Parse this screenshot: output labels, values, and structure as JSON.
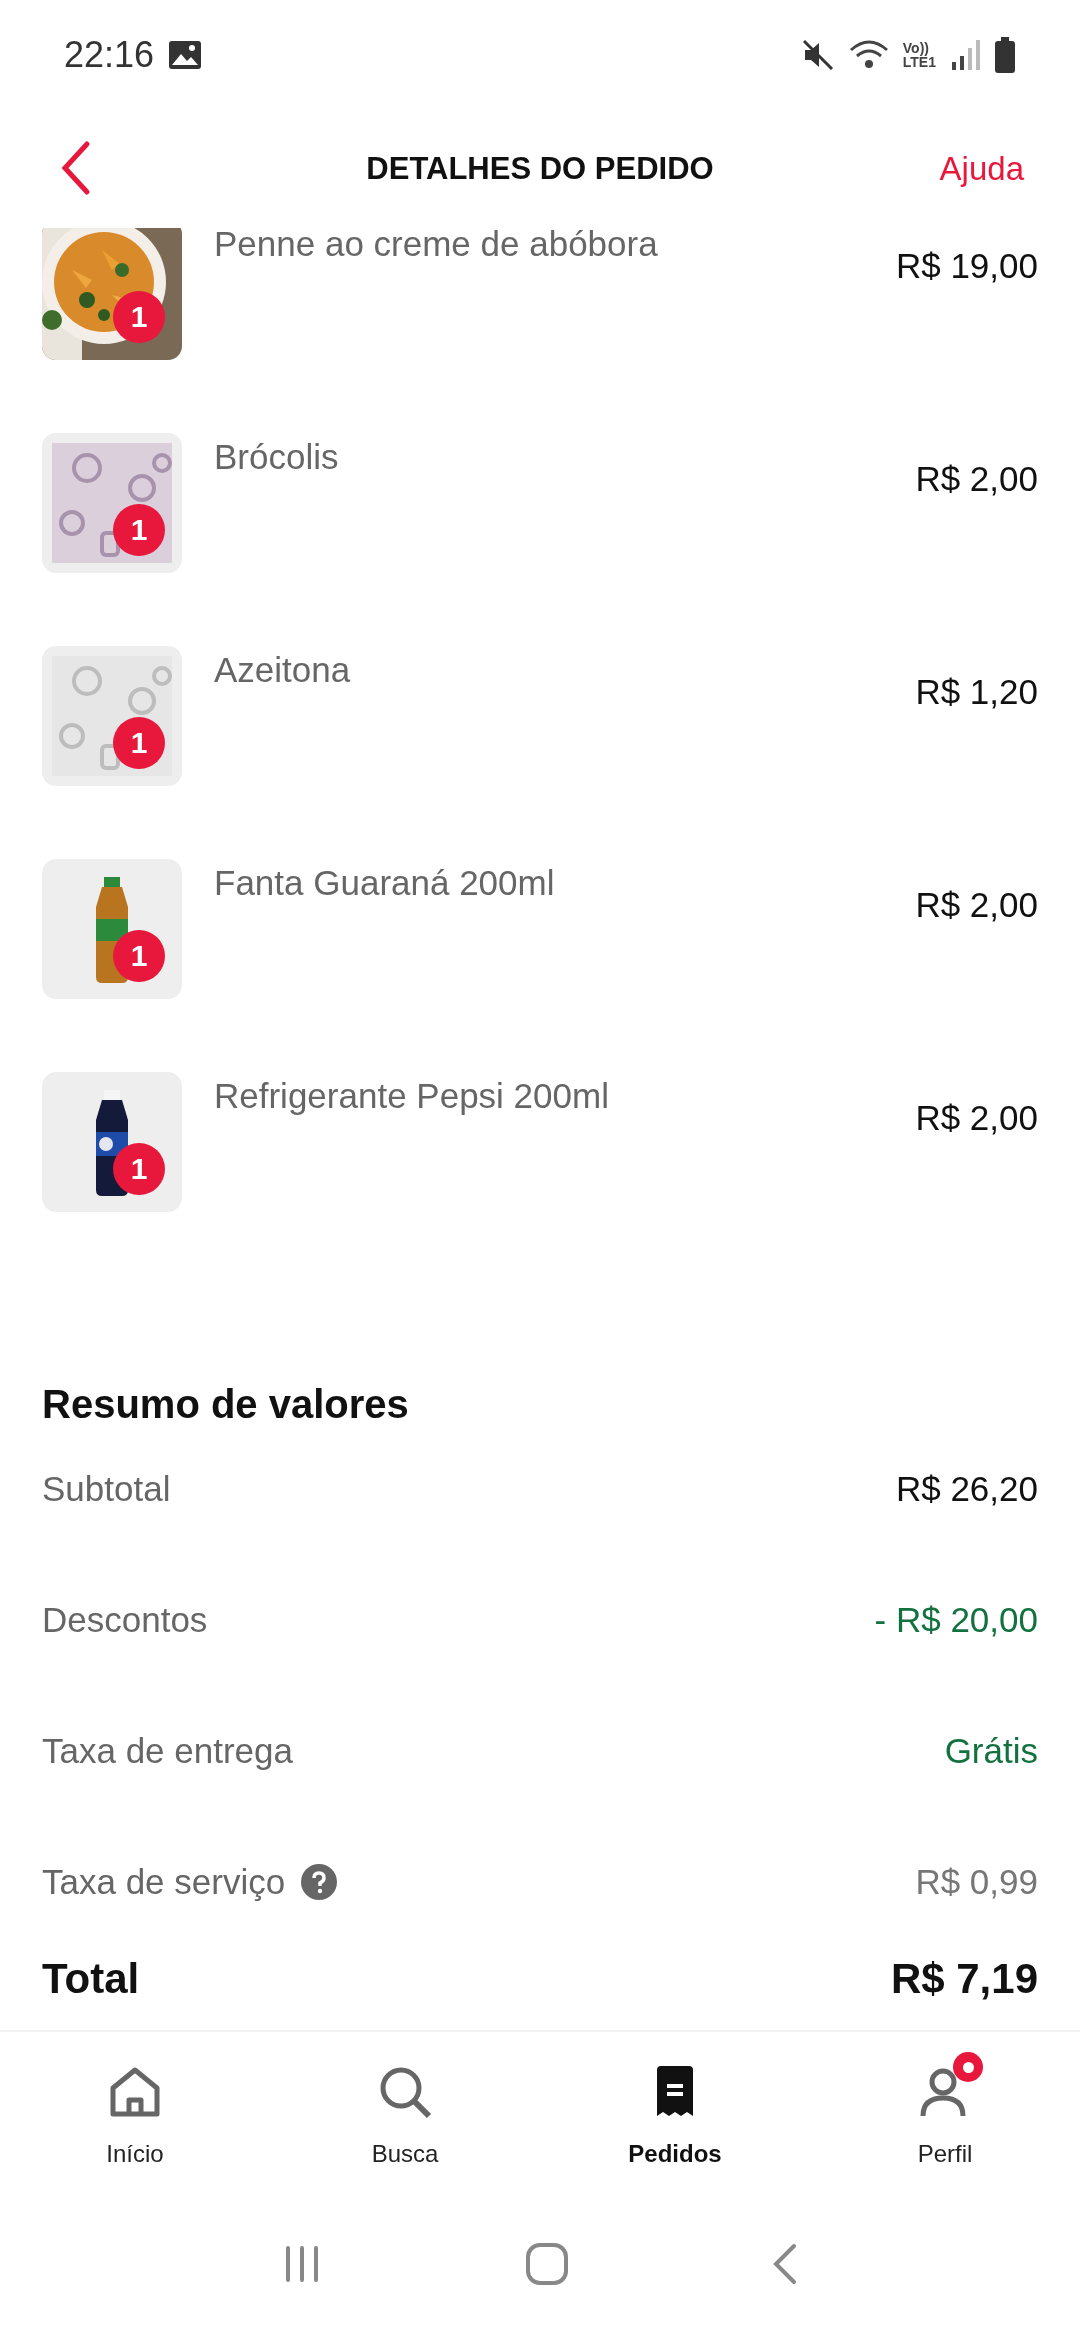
{
  "status_bar": {
    "time": "22:16",
    "network_label": [
      "Vo))",
      "LTE1"
    ]
  },
  "header": {
    "title": "DETALHES DO PEDIDO",
    "help_link": "Ajuda"
  },
  "items": [
    {
      "name": "Penne ao creme de abóbora",
      "price": "R$ 19,00",
      "quantity": "1",
      "kind": "picture"
    },
    {
      "name": "Brócolis",
      "price": "R$ 2,00",
      "quantity": "1",
      "kind": "picture"
    },
    {
      "name": "Azeitona",
      "price": "R$ 1,20",
      "quantity": "1",
      "kind": "picture"
    },
    {
      "name": "Fanta Guaraná 200ml",
      "price": "R$ 2,00",
      "quantity": "1",
      "kind": "picture"
    },
    {
      "name": "Refrigerante Pepsi 200ml",
      "price": "R$ 2,00",
      "quantity": "1",
      "kind": "picture"
    }
  ],
  "summary": {
    "title": "Resumo de valores",
    "rows": [
      {
        "label": "Subtotal",
        "value": "R$ 26,20",
        "kind": "normal",
        "help": false
      },
      {
        "label": "Descontos",
        "value": "- R$ 20,00",
        "kind": "positive",
        "help": false
      },
      {
        "label": "Taxa de entrega",
        "value": "Grátis",
        "kind": "positive",
        "help": false
      },
      {
        "label": "Taxa de serviço",
        "value": "R$ 0,99",
        "kind": "muted",
        "help": true
      }
    ],
    "total_label": "Total",
    "total_value": "R$ 7,19"
  },
  "bottom_nav": [
    {
      "label": "Início",
      "selected": false,
      "badge": false
    },
    {
      "label": "Busca",
      "selected": false,
      "badge": false
    },
    {
      "label": "Pedidos",
      "selected": true,
      "badge": false
    },
    {
      "label": "Perfil",
      "selected": false,
      "badge": true
    }
  ]
}
